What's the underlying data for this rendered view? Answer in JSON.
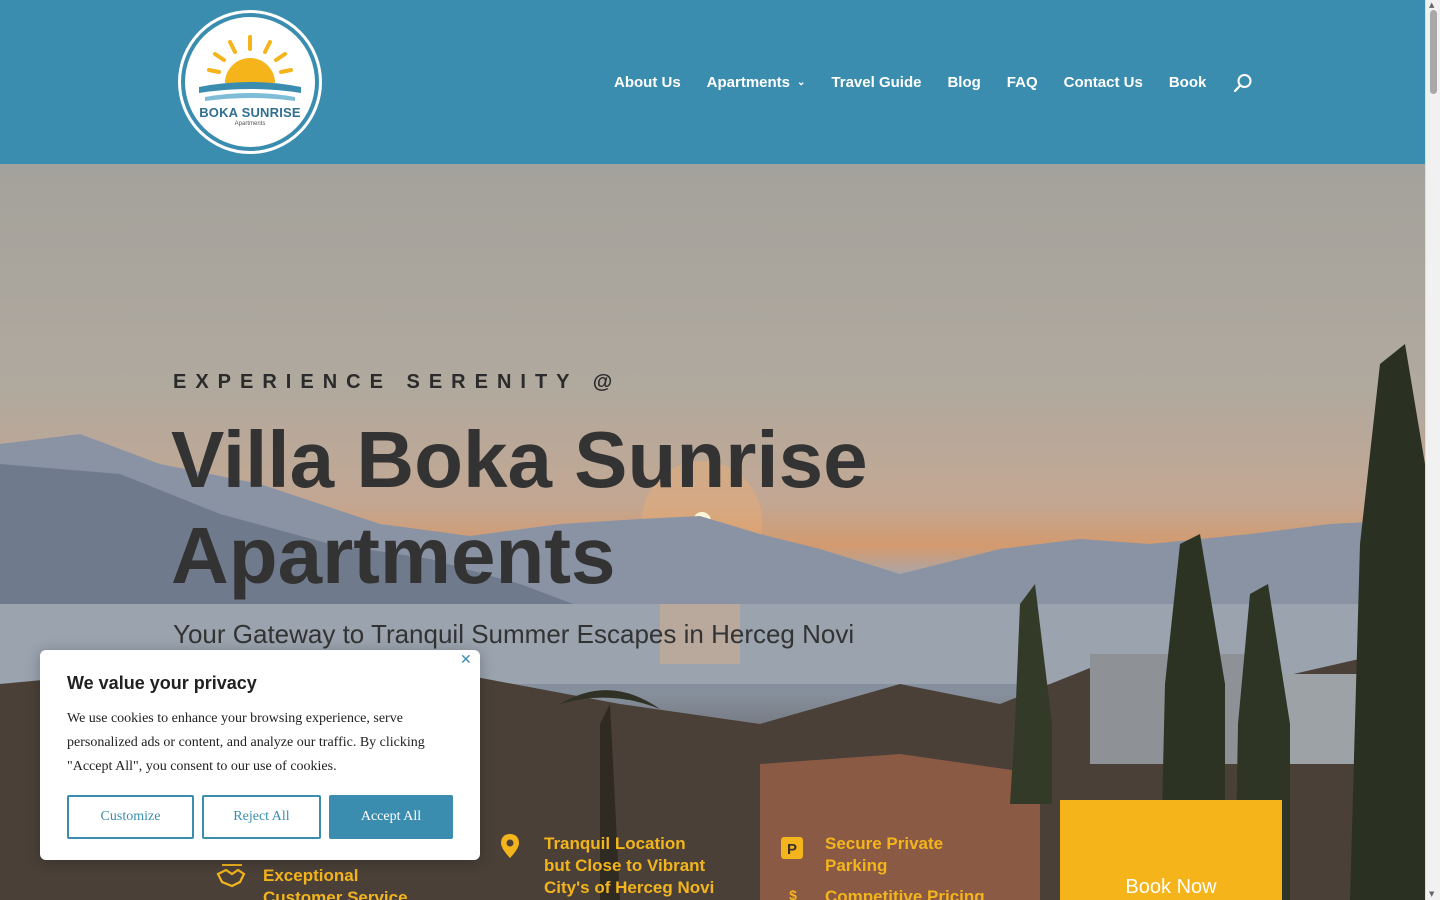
{
  "brand": {
    "name": "BOKA SUNRISE",
    "tagline": "Apartments"
  },
  "nav": {
    "items": [
      {
        "label": "About Us"
      },
      {
        "label": "Apartments",
        "has_dropdown": true
      },
      {
        "label": "Travel Guide"
      },
      {
        "label": "Blog"
      },
      {
        "label": "FAQ"
      },
      {
        "label": "Contact Us"
      },
      {
        "label": "Book"
      }
    ],
    "search_icon": "search-icon"
  },
  "hero": {
    "eyebrow": "EXPERIENCE SERENITY @",
    "title_line1": "Villa Boka Sunrise",
    "title_line2": "Apartments",
    "subtitle": "Your Gateway to Tranquil Summer Escapes in Herceg Novi"
  },
  "features": {
    "service": {
      "line1": "Exceptional",
      "line2": "Customer Service",
      "icon": "handshake-icon"
    },
    "location": {
      "line1": "Tranquil Location",
      "line2": "but Close to Vibrant",
      "line3": "City's of Herceg Novi",
      "icon": "map-pin-icon"
    },
    "parking": {
      "line1": "Secure Private",
      "line2": "Parking",
      "icon": "parking-icon"
    },
    "pricing": {
      "line1": "Competitive Pricing",
      "icon": "dollar-icon"
    }
  },
  "book_now": {
    "label": "Book Now"
  },
  "cookie": {
    "title": "We value your privacy",
    "text": "We use cookies to enhance your browsing experience, serve personalized ads or content, and analyze our traffic. By clicking \"Accept All\", you consent to our use of cookies.",
    "customize": "Customize",
    "reject": "Reject All",
    "accept": "Accept All"
  },
  "colors": {
    "header_bg": "#3b8db0",
    "accent_yellow": "#f4b41a",
    "feature_text": "#f3b41c",
    "hero_text": "#333333"
  }
}
